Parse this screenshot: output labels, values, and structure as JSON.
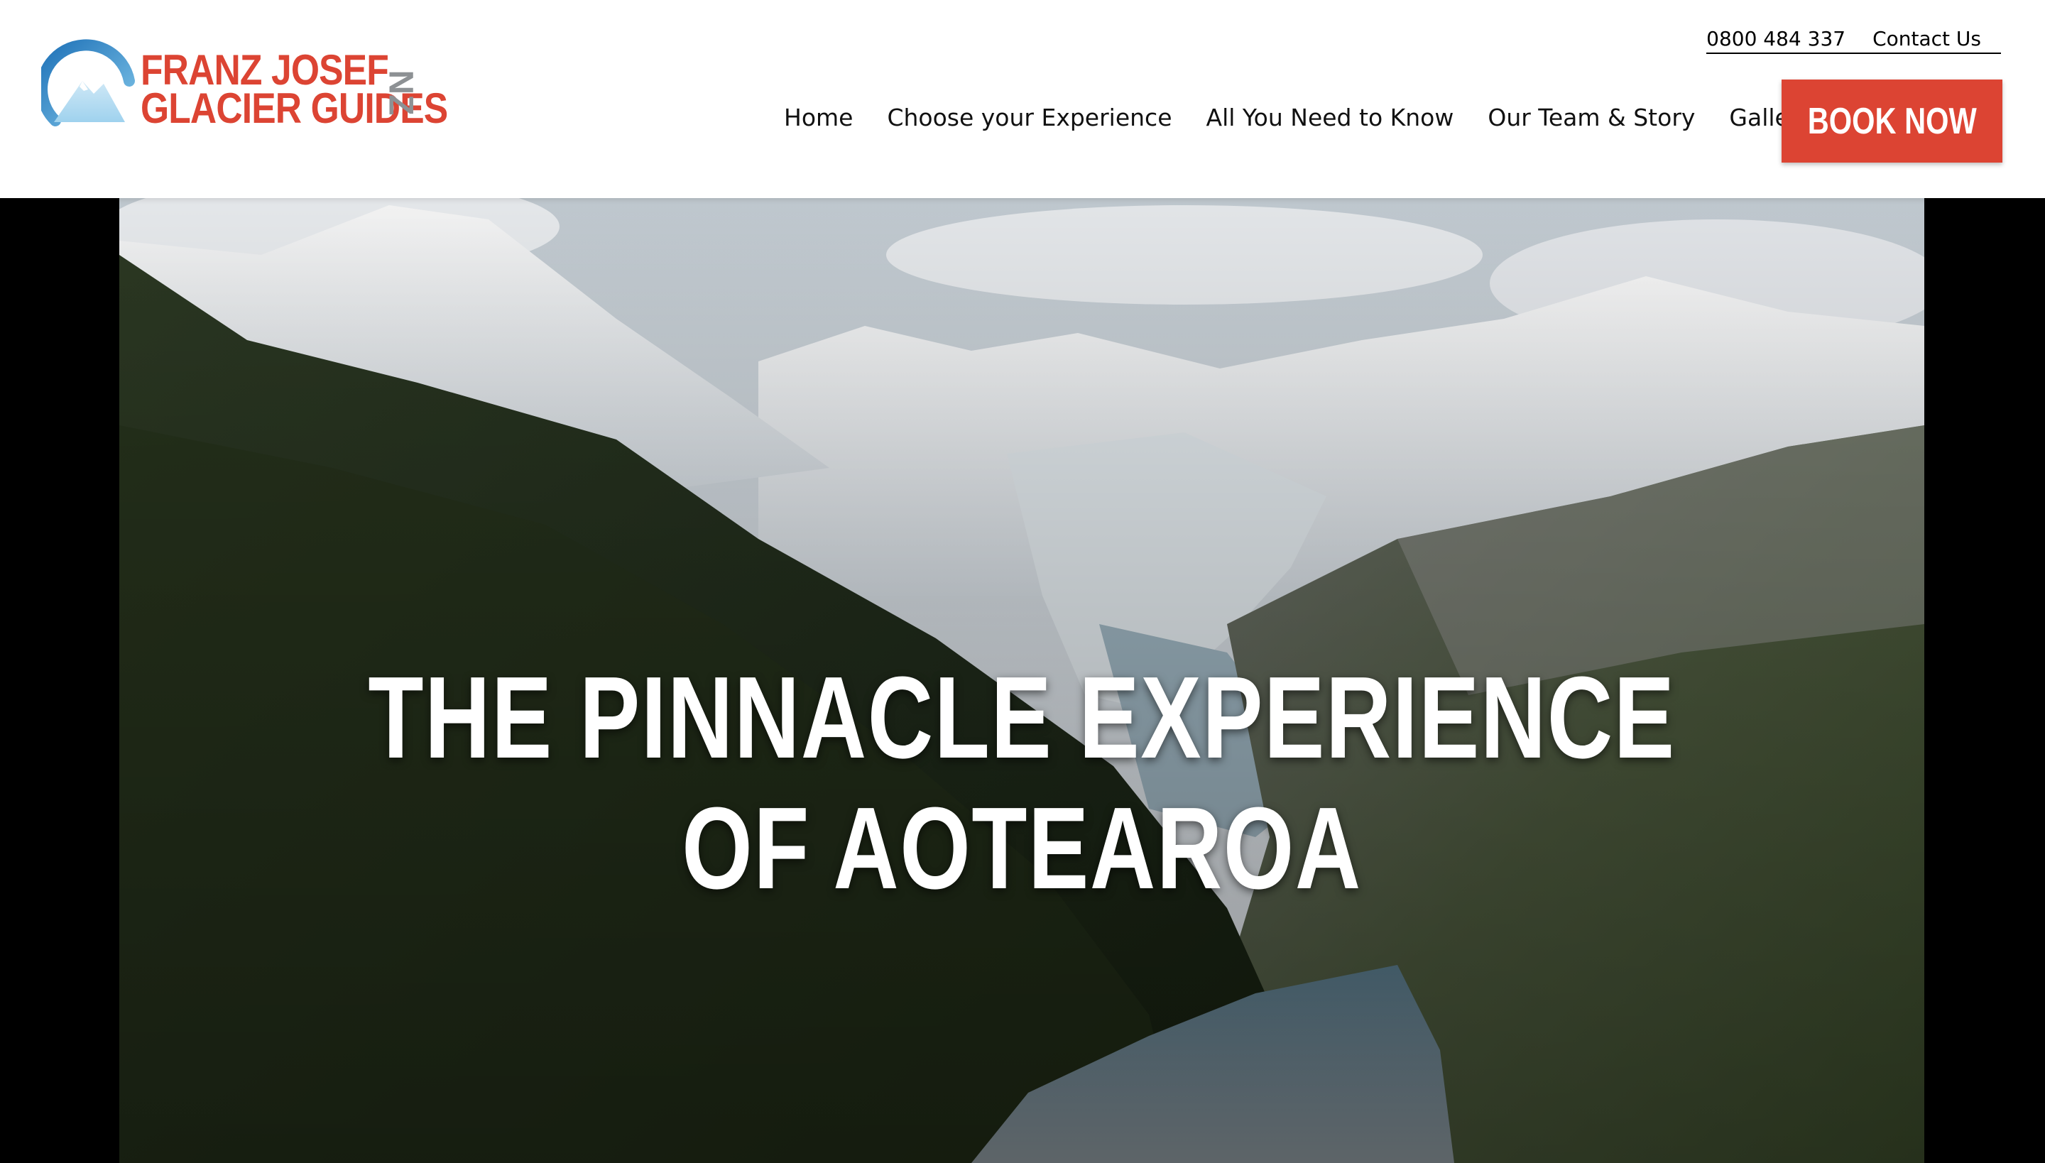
{
  "brand": {
    "line1": "FRANZ JOSEF",
    "line2": "GLACIER GUIDES",
    "suffix": "NZ",
    "accent_color": "#dc4433",
    "logo_icon": "mountain-arc-icon"
  },
  "utility": {
    "phone": "0800 484 337",
    "contact": "Contact Us"
  },
  "nav": {
    "items": [
      {
        "label": "Home"
      },
      {
        "label": "Choose your Experience"
      },
      {
        "label": "All You Need to Know"
      },
      {
        "label": "Our Team & Story"
      },
      {
        "label": "Gallery"
      }
    ]
  },
  "cta": {
    "book_label": "BOOK NOW"
  },
  "hero": {
    "title_line1": "THE PINNACLE EXPERIENCE",
    "title_line2": "OF AOTEAROA"
  }
}
